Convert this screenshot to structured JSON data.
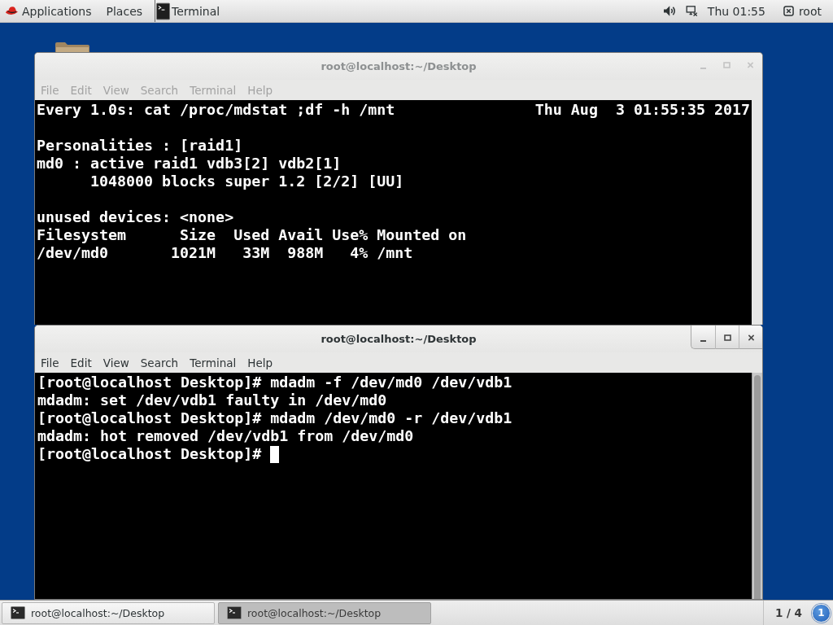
{
  "top_bar": {
    "applications": "Applications",
    "places": "Places",
    "app": "Terminal",
    "clock": "Thu 01:55",
    "user": "root"
  },
  "windows": [
    {
      "title": "root@localhost:~/Desktop",
      "active": false,
      "menu": [
        "File",
        "Edit",
        "View",
        "Search",
        "Terminal",
        "Help"
      ],
      "terminal": {
        "kind": "watch",
        "command": "Every 1.0s: cat /proc/mdstat ;df -h /mnt",
        "time": "Thu Aug  3 01:55:35 2017",
        "blocks": [
          [
            "Personalities : [raid1]",
            "md0 : active raid1 vdb3[2] vdb2[1]",
            "      1048000 blocks super 1.2 [2/2] [UU]"
          ],
          [
            "unused devices: <none>",
            "Filesystem      Size  Used Avail Use% Mounted on",
            "/dev/md0       1021M   33M  988M   4% /mnt"
          ]
        ]
      }
    },
    {
      "title": "root@localhost:~/Desktop",
      "active": true,
      "menu": [
        "File",
        "Edit",
        "View",
        "Search",
        "Terminal",
        "Help"
      ],
      "terminal": {
        "kind": "shell",
        "lines": [
          "[root@localhost Desktop]# mdadm -f /dev/md0 /dev/vdb1",
          "mdadm: set /dev/vdb1 faulty in /dev/md0",
          "[root@localhost Desktop]# mdadm /dev/md0 -r /dev/vdb1",
          "mdadm: hot removed /dev/vdb1 from /dev/md0",
          "[root@localhost Desktop]#"
        ],
        "cursor": true
      }
    }
  ],
  "taskbar": {
    "tasks": [
      {
        "label": "root@localhost:~/Desktop",
        "selected": false
      },
      {
        "label": "root@localhost:~/Desktop",
        "selected": true
      }
    ],
    "workspace": "1 / 4",
    "notifications": "1"
  }
}
